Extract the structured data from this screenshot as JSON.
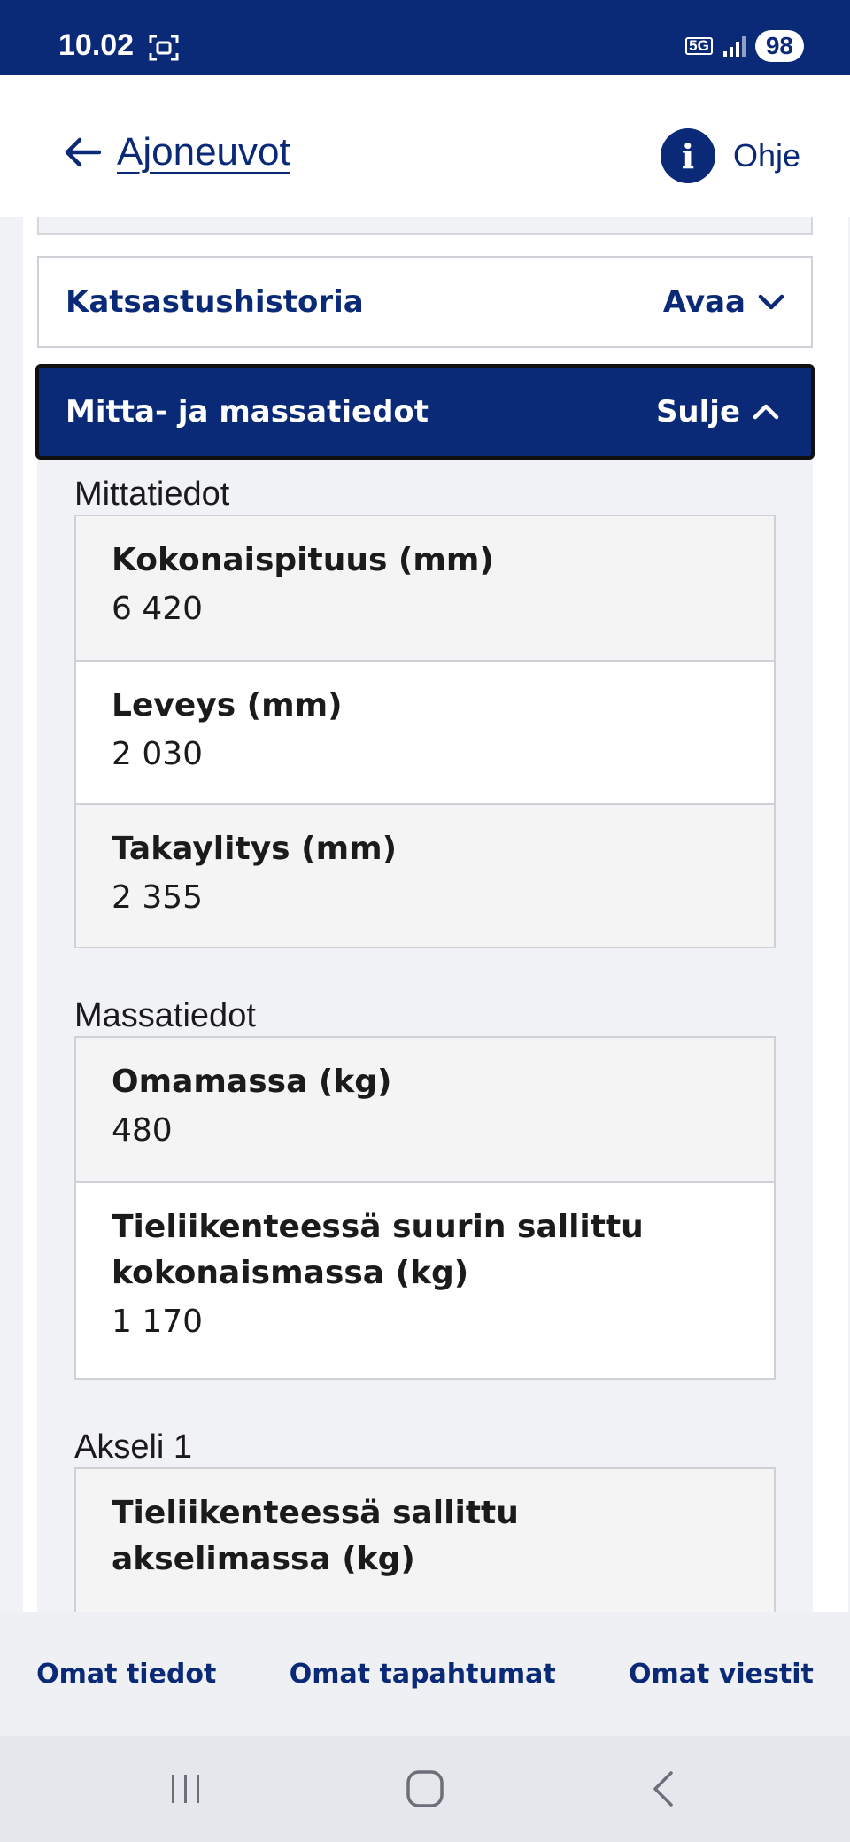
{
  "status_bar": {
    "time": "10.02",
    "network": "5G",
    "battery": "98"
  },
  "header": {
    "back_label": "Ajoneuvot",
    "help_label": "Ohje",
    "help_icon_glyph": "i"
  },
  "accordions": {
    "inspection_history": {
      "title": "Katsastushistoria",
      "action": "Avaa"
    },
    "dimensions_mass": {
      "title": "Mitta- ja massatiedot",
      "action": "Sulje"
    }
  },
  "sections": {
    "dimensions": {
      "heading": "Mittatiedot",
      "rows": [
        {
          "label": "Kokonaispituus (mm)",
          "value": "6 420"
        },
        {
          "label": "Leveys (mm)",
          "value": "2 030"
        },
        {
          "label": "Takaylitys (mm)",
          "value": "2 355"
        }
      ]
    },
    "mass": {
      "heading": "Massatiedot",
      "rows": [
        {
          "label": "Omamassa (kg)",
          "value": "480"
        },
        {
          "label": "Tieliikenteessä suurin sallittu kokonaismassa (kg)",
          "value": "1 170"
        }
      ]
    },
    "axle1": {
      "heading": "Akseli 1",
      "rows": [
        {
          "label": "Tieliikenteessä sallittu akselimassa (kg)"
        }
      ]
    }
  },
  "bottom_nav": {
    "items": [
      "Omat tiedot",
      "Omat tapahtumat",
      "Omat viestit"
    ]
  },
  "colors": {
    "brand": "#0a2a78",
    "background": "#f1f2f6"
  }
}
